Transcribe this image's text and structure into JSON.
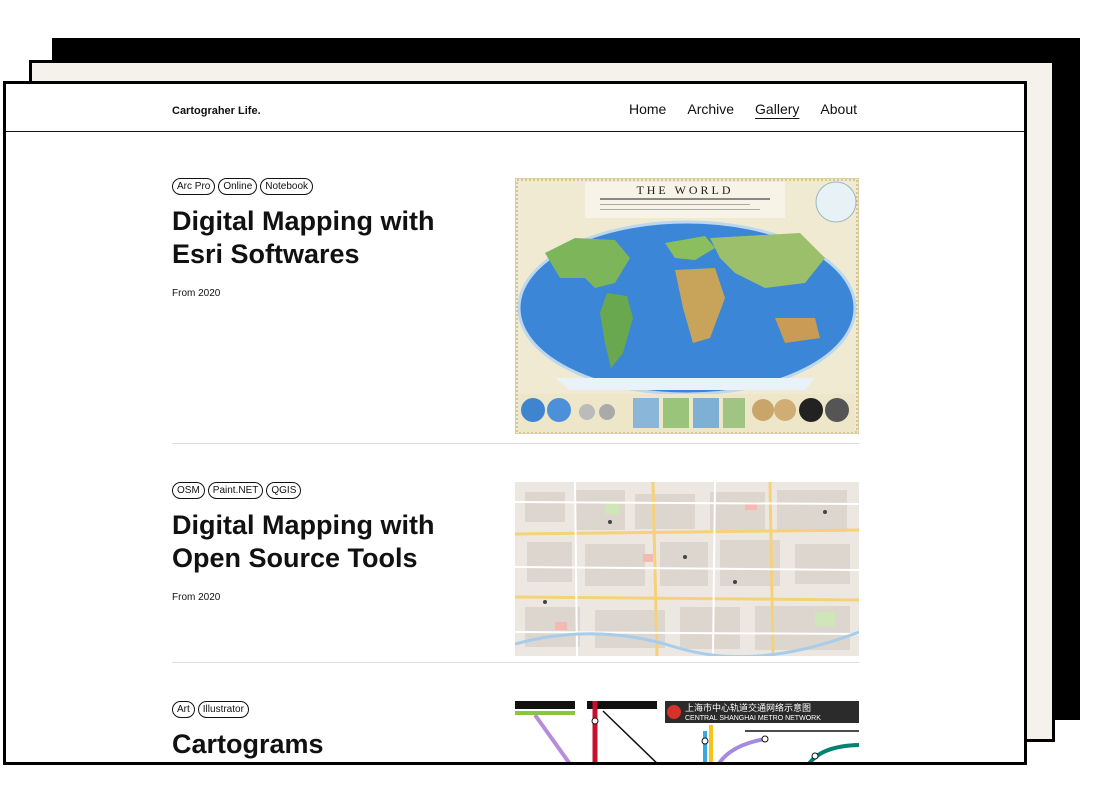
{
  "header": {
    "brand": "Cartograher Life.",
    "nav": [
      "Home",
      "Archive",
      "Gallery",
      "About"
    ],
    "active": "Gallery"
  },
  "entries": [
    {
      "tags": [
        "Arc Pro",
        "Online",
        "Notebook"
      ],
      "title_line1": "Digital Mapping with",
      "title_line2": "Esri Softwares",
      "date": "From 2020",
      "image": {
        "kind": "world-map",
        "heading": "THE WORLD"
      }
    },
    {
      "tags": [
        "OSM",
        "Paint.NET",
        "QGIS"
      ],
      "title_line1": "Digital Mapping with",
      "title_line2": "Open Source Tools",
      "date": "From 2020",
      "image": {
        "kind": "street-map"
      }
    },
    {
      "tags": [
        "Art",
        "Illustrator"
      ],
      "title_line1": "Cartograms",
      "image": {
        "kind": "metro-map",
        "heading_cn": "上海市中心轨道交通网络示意图",
        "heading_en": "CENTRAL SHANGHAI METRO NETWORK"
      }
    }
  ]
}
